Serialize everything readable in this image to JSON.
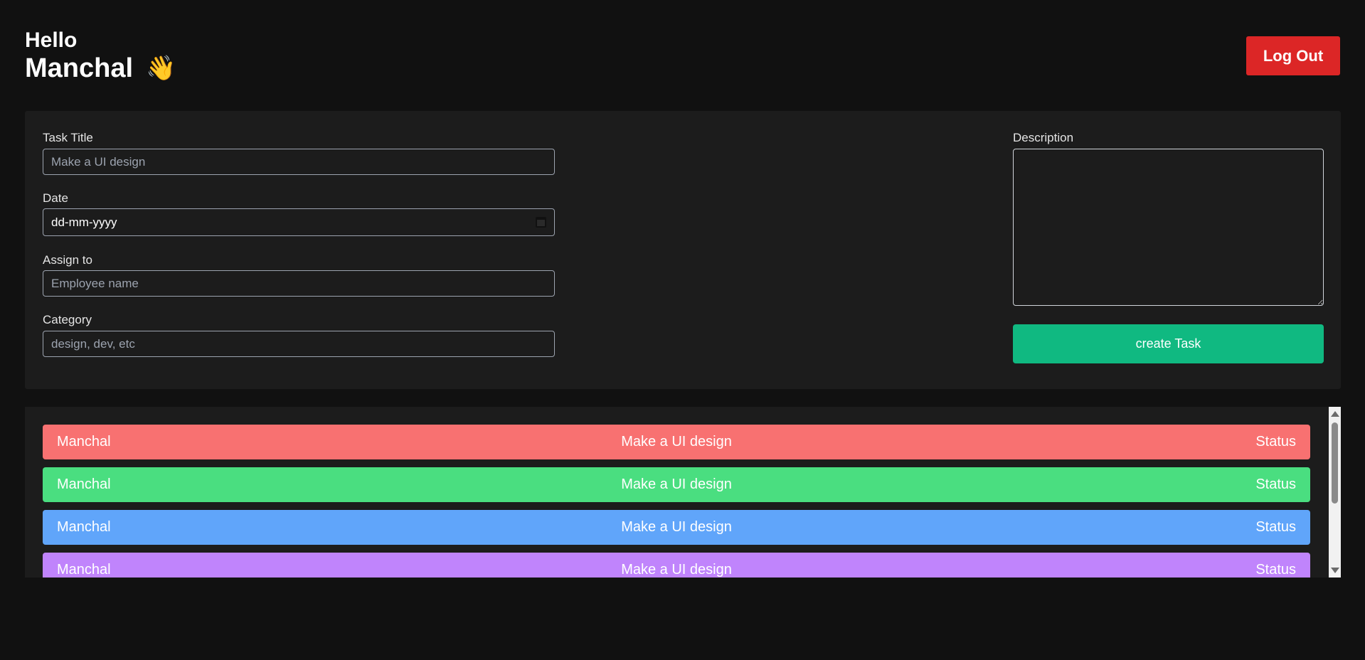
{
  "header": {
    "hello": "Hello",
    "user_name": "Manchal",
    "wave_icon": "👋",
    "logout_label": "Log Out"
  },
  "form": {
    "task_title_label": "Task Title",
    "task_title_placeholder": "Make a UI design",
    "date_label": "Date",
    "date_placeholder": "dd-mm-yyyy",
    "assign_label": "Assign to",
    "assign_placeholder": "Employee name",
    "category_label": "Category",
    "category_placeholder": "design, dev, etc",
    "description_label": "Description",
    "description_value": "",
    "create_label": "create Task"
  },
  "tasks": [
    {
      "name": "Manchal",
      "title": "Make a UI design",
      "status": "Status",
      "color": "#f87171"
    },
    {
      "name": "Manchal",
      "title": "Make a UI design",
      "status": "Status",
      "color": "#4ade80"
    },
    {
      "name": "Manchal",
      "title": "Make a UI design",
      "status": "Status",
      "color": "#60a5fa"
    },
    {
      "name": "Manchal",
      "title": "Make a UI design",
      "status": "Status",
      "color": "#c084fc"
    }
  ],
  "colors": {
    "background": "#111111",
    "panel": "#1c1c1c",
    "logout": "#dc2626",
    "create": "#10b981"
  }
}
